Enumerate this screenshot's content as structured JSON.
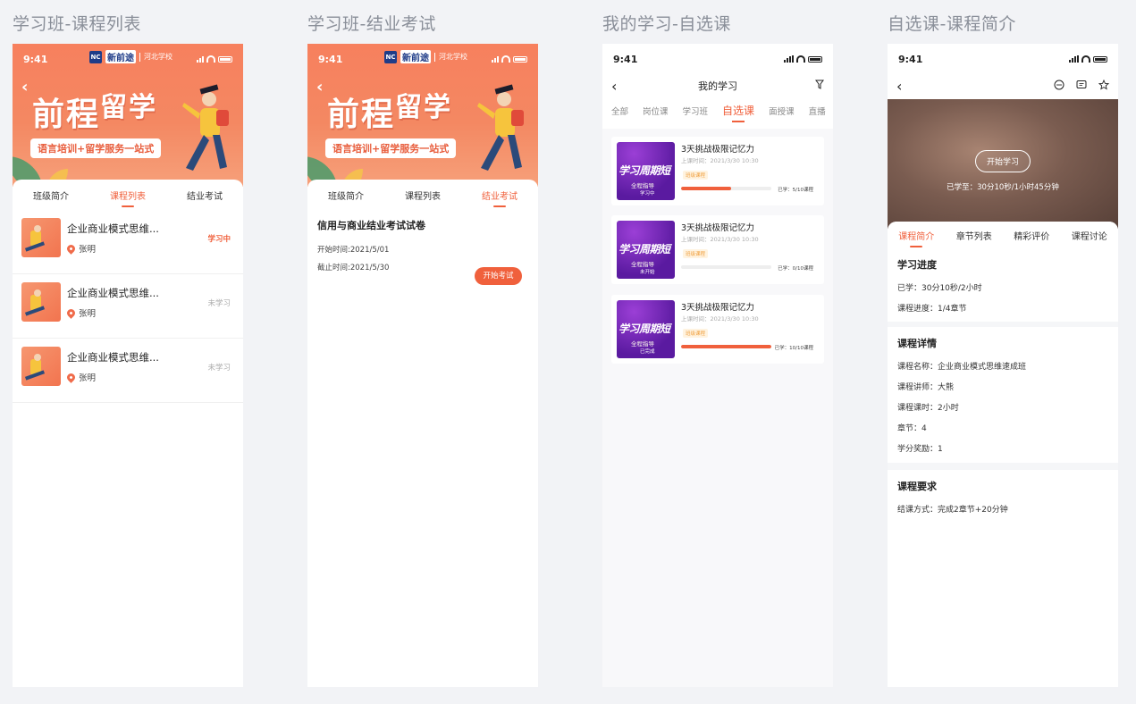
{
  "boards": [
    {
      "title": "学习班-课程列表"
    },
    {
      "title": "学习班-结业考试"
    },
    {
      "title": "我的学习-自选课"
    },
    {
      "title": "自选课-课程简介"
    }
  ],
  "status_time": "9:41",
  "banner": {
    "brand_name": "新前途",
    "school": "河北学校",
    "slogan_main": "前程",
    "slogan_tail": "留学",
    "subline": "语言培训+留学服务一站式",
    "back": "‹"
  },
  "class_tabs": [
    "班级简介",
    "课程列表",
    "结业考试"
  ],
  "course_list": [
    {
      "title": "企业商业模式思维...",
      "teacher": "张明",
      "status": "学习中"
    },
    {
      "title": "企业商业模式思维...",
      "teacher": "张明",
      "status": "未学习"
    },
    {
      "title": "企业商业模式思维...",
      "teacher": "张明",
      "status": "未学习"
    }
  ],
  "exam": {
    "title": "信用与商业结业考试试卷",
    "start": "开始时间:2021/5/01",
    "end": "截止时间:2021/5/30",
    "button": "开始考试"
  },
  "my_study": {
    "back": "‹",
    "title": "我的学习",
    "filter_icon": "filter-icon",
    "tabs": [
      "全部",
      "岗位课",
      "学习班",
      "自选课",
      "面授课",
      "直播"
    ],
    "active_tab": 3,
    "cards": [
      {
        "title": "3天挑战极限记忆力",
        "time": "上课时间：2021/3/30 10:30",
        "tag": "班级课程",
        "thumb_title": "学习周期短",
        "thumb_sub": "全程指导",
        "thumb_state": "学习中",
        "progress": 0.55,
        "count": "已学：5/10课程"
      },
      {
        "title": "3天挑战极限记忆力",
        "time": "上课时间：2021/3/30 10:30",
        "tag": "班级课程",
        "thumb_title": "学习周期短",
        "thumb_sub": "全程指导",
        "thumb_state": "未开始",
        "progress": 0.0,
        "count": "已学：0/10课程"
      },
      {
        "title": "3天挑战极限记忆力",
        "time": "上课时间：2021/3/30 10:30",
        "tag": "班级课程",
        "thumb_title": "学习周期短",
        "thumb_sub": "全程指导",
        "thumb_state": "已完成",
        "progress": 1.0,
        "count": "已学：10/10课程"
      }
    ]
  },
  "intro": {
    "back": "‹",
    "start_btn": "开始学习",
    "learned": "已学至：30分10秒/1小时45分钟",
    "tabs": [
      "课程简介",
      "章节列表",
      "精彩评价",
      "课程讨论"
    ],
    "progress_title": "学习进度",
    "progress_lines": [
      "已学：30分10秒/2小时",
      "课程进度：1/4章节"
    ],
    "detail_title": "课程详情",
    "detail_lines": [
      "课程名称：企业商业模式思维速成班",
      "课程讲师：大熊",
      "课程课时：2小时",
      "章节：4",
      "学分奖励：1"
    ],
    "req_title": "课程要求",
    "req_lines": [
      "结课方式：完成2章节+20分钟"
    ]
  },
  "colors": {
    "accent": "#f0603c",
    "banner": "#f7805e",
    "purple": "#5a1aa0"
  }
}
